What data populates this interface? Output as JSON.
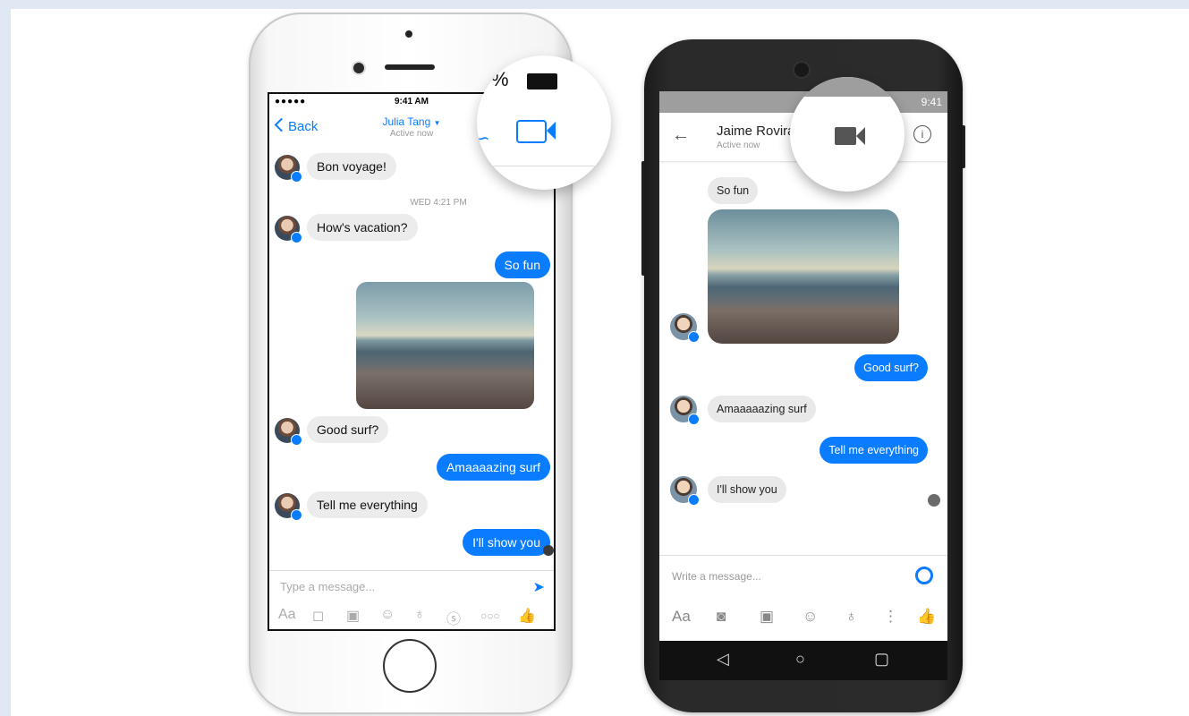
{
  "iphone": {
    "status": {
      "signal": "●●●●● ",
      "time": "9:41 AM"
    },
    "nav": {
      "back": "Back",
      "title": "Julia Tang",
      "subtitle": "Active now"
    },
    "messages": [
      {
        "dir": "in",
        "text": "Bon voyage!"
      },
      {
        "stamp": "WED 4:21 PM"
      },
      {
        "dir": "in",
        "text": "How's vacation?"
      },
      {
        "dir": "out",
        "text": "So fun"
      },
      {
        "dir": "in",
        "text": "Good surf?"
      },
      {
        "dir": "out",
        "text": "Amaaaazing surf"
      },
      {
        "dir": "in",
        "text": "Tell me everything"
      },
      {
        "dir": "out",
        "text": "I'll show you"
      }
    ],
    "input": {
      "placeholder": "Type a message..."
    },
    "tools": [
      "Aa",
      "camera-icon",
      "gallery-icon",
      "emoji-icon",
      "mic-icon",
      "payment-icon",
      "more-icon",
      "like-icon"
    ],
    "zoom": {
      "battery_pct": "%"
    }
  },
  "android": {
    "status": {
      "time": "9:41"
    },
    "nav": {
      "title": "Jaime Rovira",
      "subtitle": "Active now"
    },
    "messages": [
      {
        "dir": "in",
        "text": "So fun"
      },
      {
        "dir": "out",
        "text": "Good surf?"
      },
      {
        "dir": "in",
        "text": "Amaaaaazing surf"
      },
      {
        "dir": "out",
        "text": "Tell me everything"
      },
      {
        "dir": "in",
        "text": "I'll show you"
      }
    ],
    "input": {
      "placeholder": "Write a message..."
    },
    "tools": [
      "Aa",
      "camera-icon",
      "image-icon",
      "emoji-icon",
      "mic-icon",
      "more-icon",
      "like-icon"
    ]
  },
  "colors": {
    "accent": "#0a7cff",
    "bubble_in": "#ececec"
  }
}
